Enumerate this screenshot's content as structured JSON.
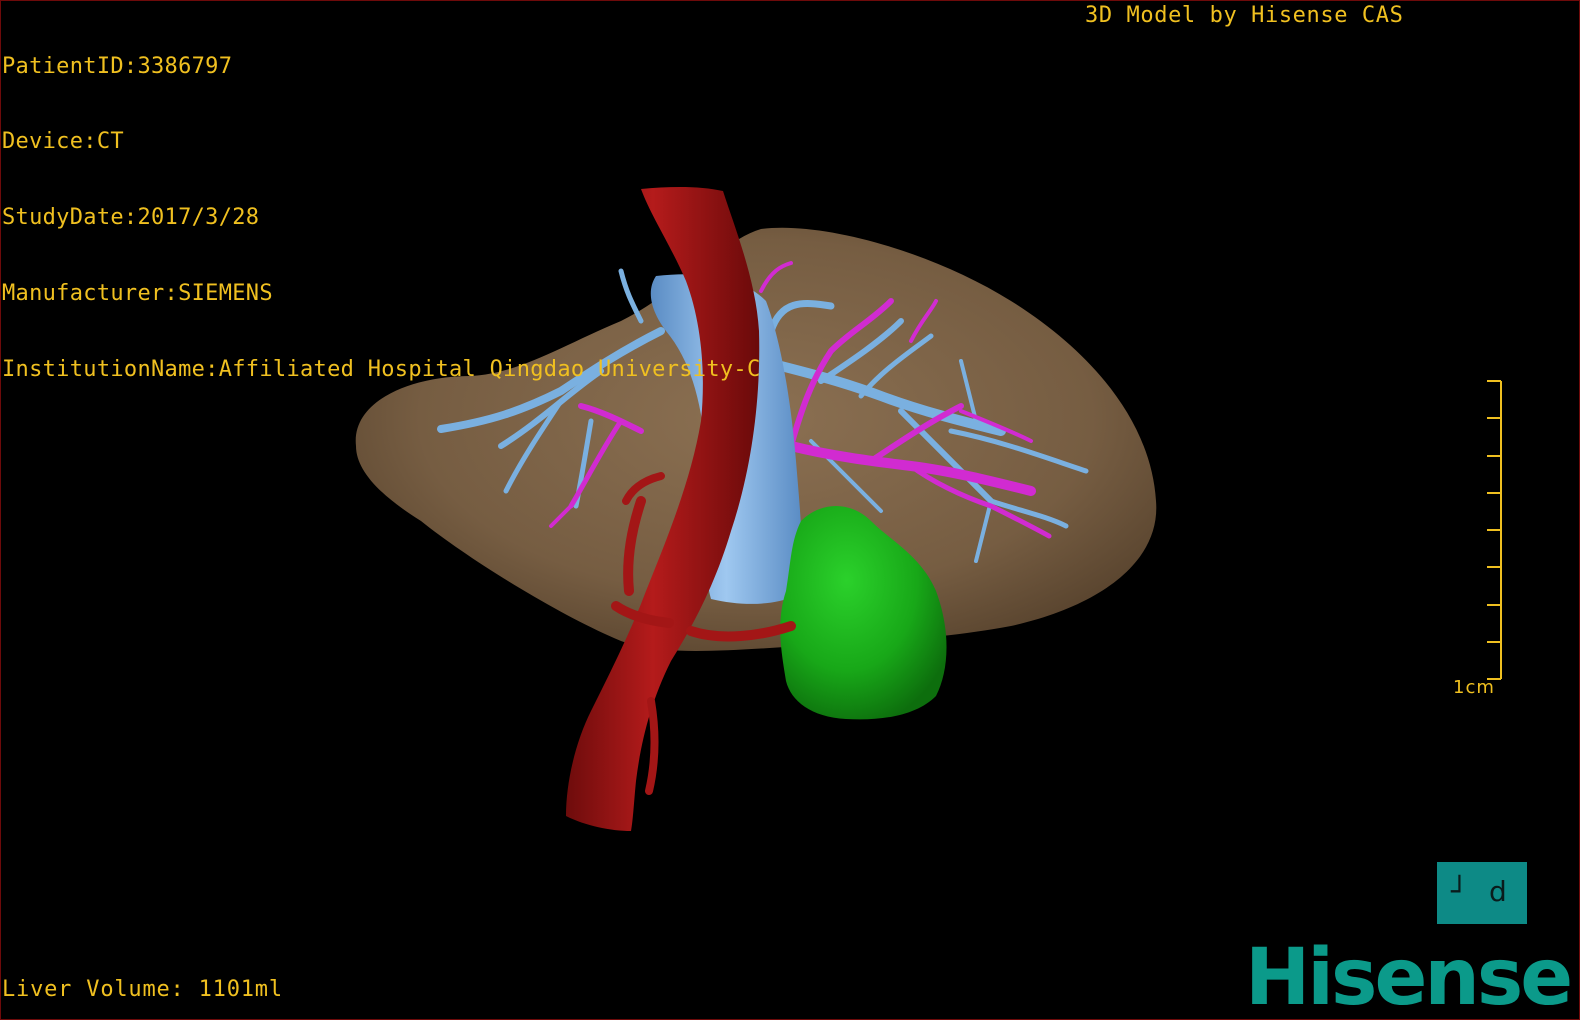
{
  "patient_info": {
    "patient_id": "PatientID:3386797",
    "device": "Device:CT",
    "study_date": "StudyDate:2017/3/28",
    "manufacturer": "Manufacturer:SIEMENS",
    "institution": "InstitutionName:Affiliated Hospital Qingdao University-C"
  },
  "header": {
    "model_caption": "3D Model by Hisense CAS"
  },
  "footer": {
    "liver_volume": "Liver Volume: 1101ml"
  },
  "scale_bar": {
    "label": "1cm",
    "ticks": 9
  },
  "orientation": {
    "left_glyph": "┘",
    "right_glyph": "d"
  },
  "branding": {
    "logo_text": "Hisense",
    "logo_color": "#0b9a8a"
  },
  "colors": {
    "overlay_text": "#f0c020",
    "liver": "#7a6145",
    "artery": "#a31616",
    "portal_vein": "#7ab0e0",
    "hepatic_vein": "#d12bd1",
    "tumor": "#14a814",
    "background": "#000000"
  }
}
